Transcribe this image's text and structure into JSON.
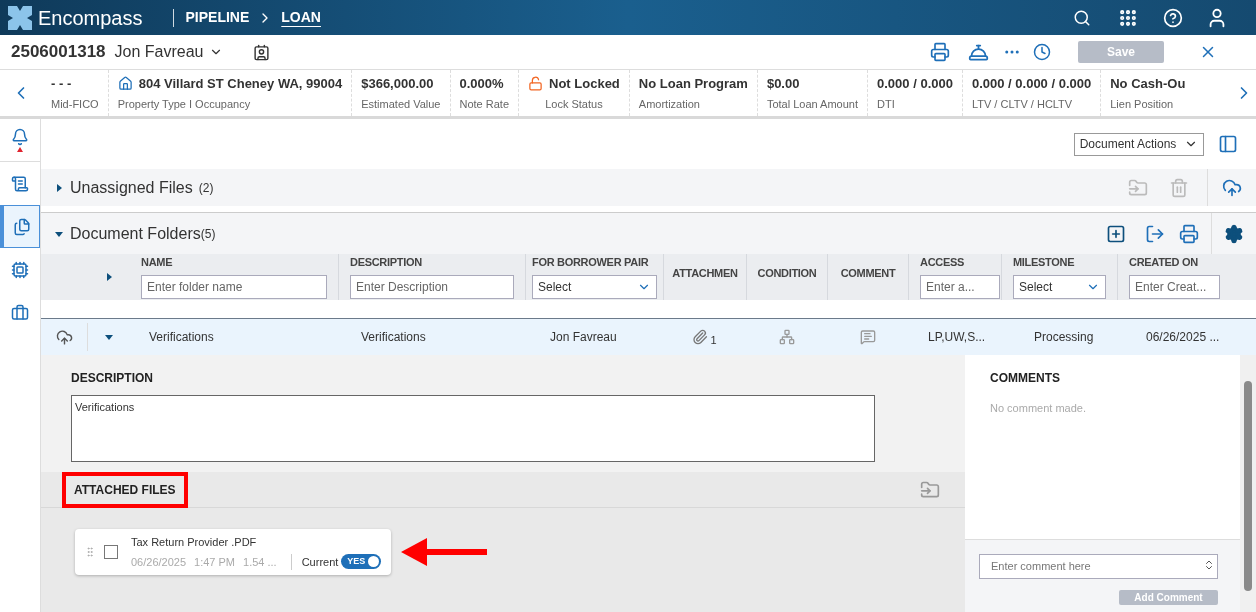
{
  "app": {
    "brand": "Encompass",
    "breadcrumbs": [
      {
        "label": "PIPELINE",
        "selected": false
      },
      {
        "label": "LOAN",
        "selected": true
      }
    ]
  },
  "loan": {
    "number": "2506001318",
    "borrower": "Jon Favreau",
    "save_label": "Save",
    "save_disabled": true
  },
  "summary": [
    {
      "value": "- - -",
      "label": "Mid-FICO"
    },
    {
      "value": "804 Villard ST Cheney WA, 99004",
      "label": "Property Type I Occupancy"
    },
    {
      "value": "$366,000.00",
      "label": "Estimated Value"
    },
    {
      "value": "0.000%",
      "label": "Note Rate"
    },
    {
      "value": "Not Locked",
      "label": "Lock Status"
    },
    {
      "value": "No Loan Program",
      "label": "Amortization"
    },
    {
      "value": "$0.00",
      "label": "Total Loan Amount"
    },
    {
      "value": "0.000 / 0.000",
      "label": "DTI"
    },
    {
      "value": "0.000 / 0.000 / 0.000",
      "label": "LTV / CLTV / HCLTV"
    },
    {
      "value": "No Cash-Ou",
      "label": "Lien Position"
    }
  ],
  "sidebar": [
    {
      "selected": false,
      "alert": true
    },
    {
      "selected": false,
      "alert": false
    },
    {
      "selected": true,
      "alert": false
    },
    {
      "selected": false,
      "alert": false
    },
    {
      "selected": false,
      "alert": false
    }
  ],
  "toolbar": {
    "document_actions": "Document Actions"
  },
  "unassigned": {
    "title": "Unassigned Files",
    "count": "(2)",
    "expanded": false
  },
  "folders": {
    "title": "Document Folders",
    "count": "(5)",
    "expanded": true,
    "columns": [
      {
        "label": "NAME",
        "filter": {
          "kind": "text",
          "placeholder": "Enter folder name"
        }
      },
      {
        "label": "DESCRIPTION",
        "filter": {
          "kind": "text",
          "placeholder": "Enter Description"
        }
      },
      {
        "label": "FOR BORROWER PAIR",
        "filter": {
          "kind": "select",
          "value": "Select"
        }
      },
      {
        "label": "ATTACHMEN"
      },
      {
        "label": "CONDITION"
      },
      {
        "label": "COMMENT"
      },
      {
        "label": "ACCESS",
        "filter": {
          "kind": "text",
          "placeholder": "Enter a..."
        }
      },
      {
        "label": "MILESTONE",
        "filter": {
          "kind": "select",
          "value": "Select"
        }
      },
      {
        "label": "CREATED ON",
        "filter": {
          "kind": "text",
          "placeholder": "Enter Creat..."
        }
      }
    ],
    "row": {
      "name": "Verifications",
      "description": "Verifications",
      "borrower_pair": "Jon Favreau",
      "attachments": "1",
      "access": "LP,UW,S...",
      "milestone": "Processing",
      "created_on": "06/26/2025 ...",
      "expanded": true,
      "selected": true
    }
  },
  "detail": {
    "description_label": "DESCRIPTION",
    "description": "Verifications",
    "attached_label": "ATTACHED FILES",
    "attached_highlighted": true,
    "files": [
      {
        "name": "Tax Return Provider .PDF",
        "date": "06/26/2025",
        "time": "1:47 PM",
        "size": "1.54 ...",
        "checked": false,
        "current_label": "Current",
        "current": true,
        "current_text": "YES",
        "arrow": true
      }
    ]
  },
  "comments": {
    "title": "COMMENTS",
    "empty": "No comment made.",
    "placeholder": "Enter comment here",
    "button": "Add Comment"
  }
}
